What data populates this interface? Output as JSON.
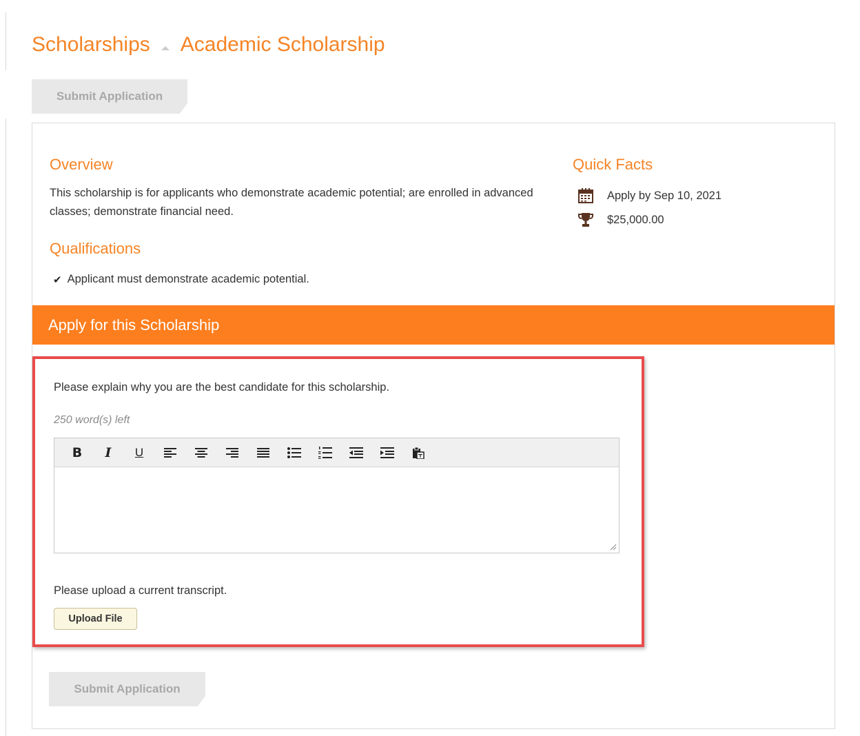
{
  "breadcrumb": {
    "parent": "Scholarships",
    "current": "Academic Scholarship"
  },
  "actions": {
    "submit_label": "Submit Application"
  },
  "overview": {
    "title": "Overview",
    "text": "This scholarship is for applicants who demonstrate academic potential; are enrolled in advanced classes; demonstrate financial need."
  },
  "qualifications": {
    "title": "Qualifications",
    "items": [
      {
        "label": "Applicant must demonstrate academic potential."
      }
    ]
  },
  "quick_facts": {
    "title": "Quick Facts",
    "deadline": "Apply by Sep 10, 2021",
    "amount": "$25,000.00",
    "deadline_icon": "calendar-icon",
    "amount_icon": "trophy-icon"
  },
  "apply": {
    "header": "Apply for this Scholarship",
    "question": "Please explain why you are the best candidate for this scholarship.",
    "words_left": "250 word(s) left",
    "editor_value": "",
    "toolbar": {
      "bold": "B",
      "italic": "I",
      "underline": "U"
    },
    "upload_prompt": "Please upload a current transcript.",
    "upload_label": "Upload File"
  },
  "colors": {
    "accent": "#f58426",
    "apply_bar": "#fd7e1e",
    "highlight": "#e84c4c",
    "icon_brown": "#5a3320"
  }
}
